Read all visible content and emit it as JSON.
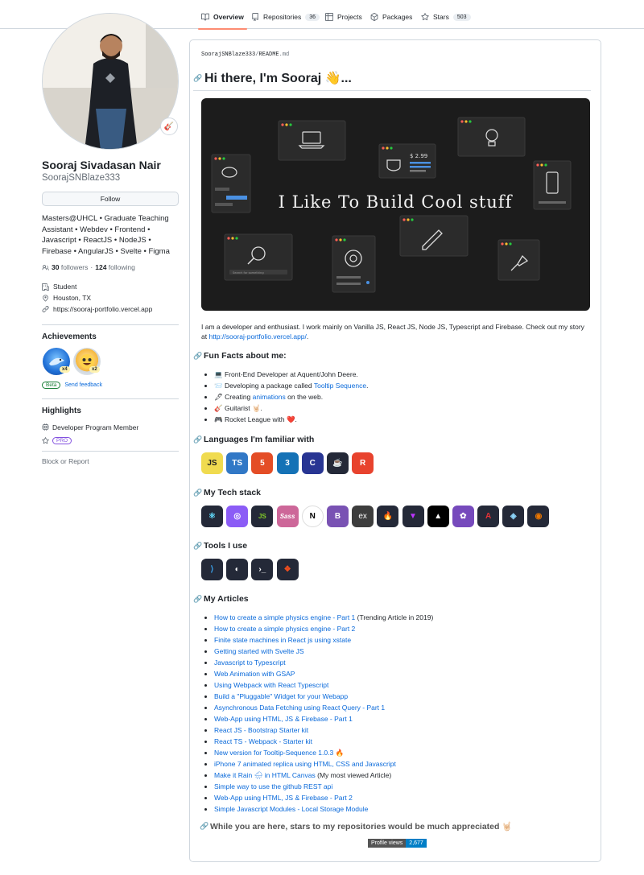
{
  "nav": {
    "tabs": [
      {
        "label": "Overview",
        "count": ""
      },
      {
        "label": "Repositories",
        "count": "36"
      },
      {
        "label": "Projects",
        "count": ""
      },
      {
        "label": "Packages",
        "count": ""
      },
      {
        "label": "Stars",
        "count": "503"
      }
    ]
  },
  "profile": {
    "name": "Sooraj Sivadasan Nair",
    "login": "SoorajSNBlaze333",
    "status_emoji": "🎸",
    "follow_label": "Follow",
    "bio": "Masters@UHCL • Graduate Teaching Assistant • Webdev • Frontend • Javascript • ReactJS • NodeJS • Firebase • AngularJS • Svelte • Figma",
    "followers": "30",
    "followers_label": "followers",
    "dot": "·",
    "following": "124",
    "following_label": "following",
    "company": "Student",
    "location": "Houston, TX",
    "website": "https://sooraj-portfolio.vercel.app"
  },
  "achievements": {
    "title": "Achievements",
    "badges": [
      {
        "mult": "x4"
      },
      {
        "mult": "x2"
      }
    ],
    "beta": "Beta",
    "feedback": "Send feedback"
  },
  "highlights": {
    "title": "Highlights",
    "program": "Developer Program Member",
    "pro": "PRO",
    "block": "Block or Report"
  },
  "readme": {
    "crumb_user": "SoorajSNBlaze333",
    "crumb_sep": "/",
    "crumb_file": "README",
    "crumb_ext": ".md",
    "title": "Hi there, I'm Sooraj 👋...",
    "banner_text": "I Like To Build Cool stuff",
    "banner_search": "Search for something",
    "banner_price": "$ 2.99",
    "intro": "I am a developer and enthusiast. I work mainly on Vanilla JS, React JS, Node JS, Typescript and Firebase. Check out my story at",
    "intro_link": "http://sooraj-portfolio.vercel.app/",
    "intro_end": ".",
    "fun_title": "Fun Facts about me:",
    "facts": {
      "f1": "💻 Front-End Developer at Aquent/John Deere.",
      "f2_pre": "📨 Developing a package called ",
      "f2_link": "Tooltip Sequence",
      "f2_post": ".",
      "f3_pre": "🖋 Creating ",
      "f3_link": "animations",
      "f3_post": " on the web.",
      "f4": "🎸 Guitarist 🤘🏻.",
      "f5": "🎮 Rocket League with ❤️."
    },
    "lang_title": "Languages I'm familiar with",
    "stack_title": "My Tech stack",
    "tools_title": "Tools I use",
    "articles_title": "My Articles",
    "articles": [
      {
        "t": "How to create a simple physics engine - Part 1",
        "note": " (Trending Article in 2019)"
      },
      {
        "t": "How to create a simple physics engine - Part 2",
        "note": ""
      },
      {
        "t": "Finite state machines in React js using xstate",
        "note": ""
      },
      {
        "t": "Getting started with Svelte JS",
        "note": ""
      },
      {
        "t": "Javascript to Typescript",
        "note": ""
      },
      {
        "t": "Web Animation with GSAP",
        "note": ""
      },
      {
        "t": "Using Webpack with React Typescript",
        "note": ""
      },
      {
        "t": "Build a \"Pluggable\" Widget for your Webapp",
        "note": ""
      },
      {
        "t": "Asynchronous Data Fetching using React Query - Part 1",
        "note": ""
      },
      {
        "t": "Web-App using HTML, JS & Firebase - Part 1",
        "note": ""
      },
      {
        "t": "React JS - Bootstrap Starter kit",
        "note": ""
      },
      {
        "t": "React TS - Webpack - Starter kit",
        "note": ""
      },
      {
        "t": "New version for Tooltip-Sequence 1.0.3 🔥",
        "note": ""
      },
      {
        "t": "iPhone 7 animated replica using HTML, CSS and Javascript",
        "note": ""
      },
      {
        "t": "Make it Rain 🌧 in HTML Canvas",
        "note": " (My most viewed Article)"
      },
      {
        "t": "Simple way to use the github REST api",
        "note": ""
      },
      {
        "t": "Web-App using HTML, JS & Firebase - Part 2",
        "note": ""
      },
      {
        "t": "Simple Javascript Modules - Local Storage Module",
        "note": ""
      }
    ],
    "stars_note": "While you are here, stars to my repositories would be much appreciated 🤘🏻",
    "views_label": "Profile views",
    "views_count": "2,677"
  },
  "colors": {
    "accent": "#fd8c73",
    "link": "#0969da",
    "banner": "#1c1c1c"
  }
}
